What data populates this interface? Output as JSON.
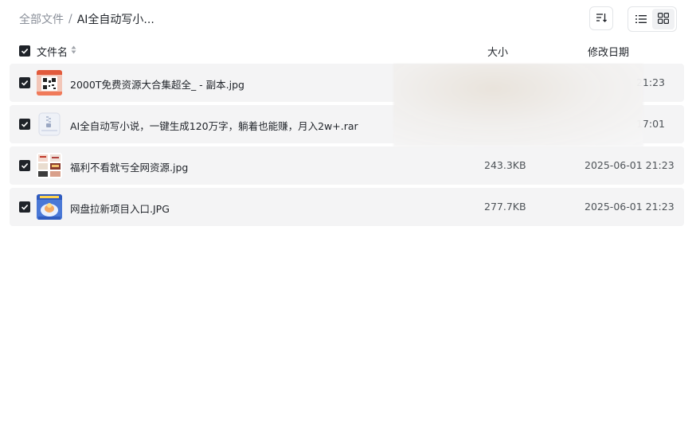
{
  "breadcrumb": {
    "root": "全部文件",
    "separator": "/",
    "current": "AI全自动写小..."
  },
  "toolbar": {
    "sort_icon": "sort-icon",
    "list_view_icon": "list-view-icon",
    "grid_view_icon": "grid-view-icon",
    "active_view": "list"
  },
  "table": {
    "headers": {
      "name": "文件名",
      "size": "大小",
      "date": "修改日期"
    },
    "rows": [
      {
        "name": "2000T免费资源大合集超全_ - 副本.jpg",
        "size": "",
        "date": "21:23",
        "checked": true,
        "thumb": "qr-poster-thumbnail"
      },
      {
        "name": "AI全自动写小说，一键生成120万字，躺着也能赚，月入2w+.rar",
        "size": "",
        "date": "17:01",
        "checked": true,
        "thumb": "archive-file-icon"
      },
      {
        "name": "福利不看就亏全网资源.jpg",
        "size": "243.3KB",
        "date": "2025-06-01 21:23",
        "checked": true,
        "thumb": "collage-thumbnail"
      },
      {
        "name": "网盘拉新项目入口.JPG",
        "size": "277.7KB",
        "date": "2025-06-01 21:23",
        "checked": true,
        "thumb": "promo-thumbnail"
      }
    ]
  },
  "colors": {
    "checkbox": "#1f2329",
    "row_background": "#f4f4f5",
    "muted_text": "#8a8f99"
  }
}
